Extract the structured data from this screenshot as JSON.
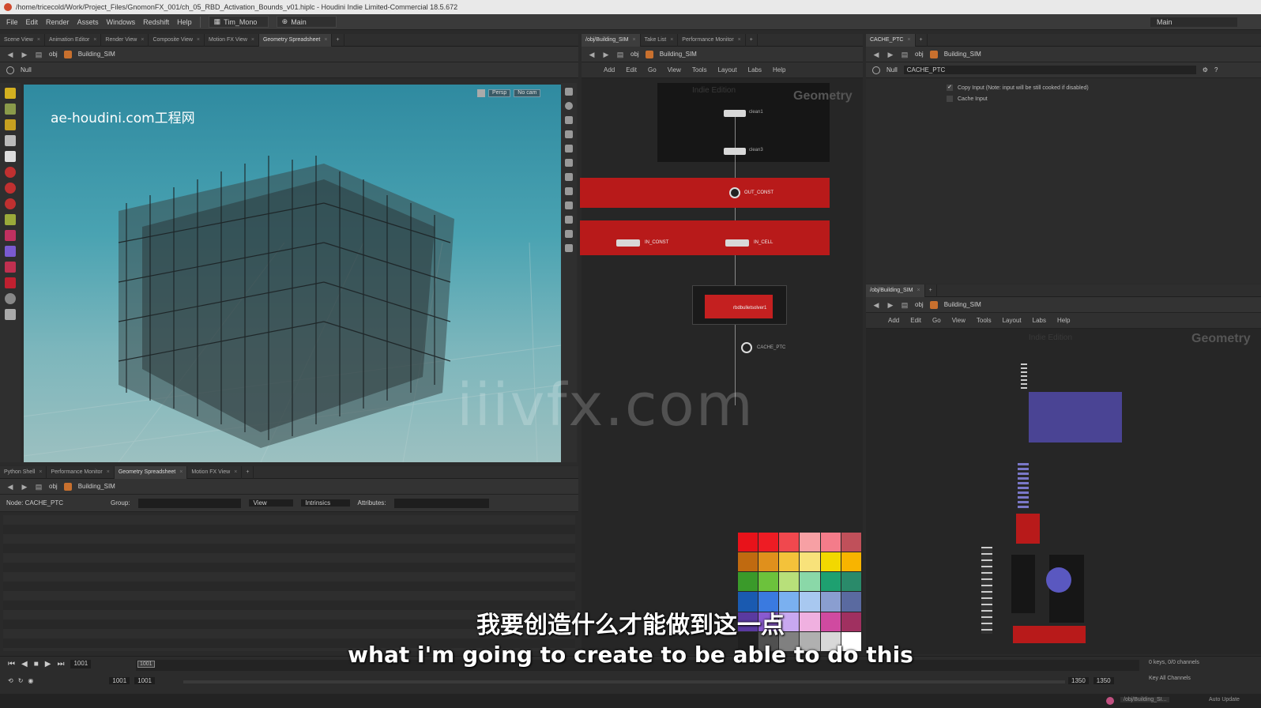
{
  "window": {
    "title": "/home/tricecold/Work/Project_Files/GnomonFX_001/ch_05_RBD_Activation_Bounds_v01.hiplc - Houdini Indie Limited-Commercial 18.5.672"
  },
  "menubar": {
    "items": [
      "File",
      "Edit",
      "Render",
      "Assets",
      "Windows",
      "Redshift",
      "Help"
    ],
    "desktop": "Tim_Mono",
    "desktop_right": "Main",
    "right_desktop": "Main"
  },
  "viewer_pane": {
    "tabs": [
      "Scene View",
      "Animation Editor",
      "Render View",
      "Composite View",
      "Motion FX View",
      "Geometry Spreadsheet"
    ],
    "path": [
      "obj",
      "Building_SIM"
    ],
    "node_label": "Null",
    "cam_buttons": [
      "Persp",
      "No cam"
    ],
    "watermark": "ae-houdini.com工程网"
  },
  "center_watermark": "iiivfx.com",
  "network_top": {
    "tabs": [
      "/obj/Building_SIM",
      "Take List",
      "Performance Monitor"
    ],
    "path": [
      "obj",
      "Building_SIM"
    ],
    "menu": [
      "Add",
      "Edit",
      "Go",
      "View",
      "Tools",
      "Layout",
      "Labs",
      "Help"
    ],
    "context_label": "Geometry",
    "faint_label": "Indie Edition",
    "nodes": {
      "n1": "clean1",
      "n2": "clean3",
      "out_const": "OUT_CONST",
      "in_const": "IN_CONST",
      "in_cell": "IN_CELL",
      "solver": "rbdbulletsolver1",
      "cache": "CACHE_PTC"
    }
  },
  "params_pane": {
    "tabs": [
      "CACHE_PTC"
    ],
    "path": [
      "obj",
      "Building_SIM"
    ],
    "node_type": "Null",
    "node_name": "CACHE_PTC",
    "params": [
      {
        "label": "Copy Input (Note: input will be still cooked if disabled)",
        "checked": true
      },
      {
        "label": "Cache Input",
        "checked": false
      }
    ]
  },
  "network_bottom": {
    "tabs": [
      "/obj/Building_SIM"
    ],
    "path": [
      "obj",
      "Building_SIM"
    ],
    "menu": [
      "Add",
      "Edit",
      "Go",
      "View",
      "Tools",
      "Layout",
      "Labs",
      "Help"
    ],
    "context_label": "Geometry",
    "faint_label": "Indie Edition"
  },
  "spreadsheet_pane": {
    "tabs": [
      "Python Shell",
      "Performance Monitor",
      "Geometry Spreadsheet",
      "Motion FX View"
    ],
    "path": [
      "obj",
      "Building_SIM"
    ],
    "node_label": "Node: CACHE_PTC",
    "group_label": "Group:",
    "view_label": "View",
    "intrinsics_label": "Intrinsics",
    "attributes_label": "Attributes:"
  },
  "timeline": {
    "current_frame": "1001",
    "frame_marker": "1001",
    "start": "1001",
    "start2": "1001",
    "end": "1350",
    "end2": "1350",
    "keys_label": "0 keys, 0/0 channels",
    "key_all": "Key All Channels",
    "auto_update": "Auto Update",
    "path_status": "/obj/Building_SI..."
  },
  "subtitles": {
    "cn": "我要创造什么才能做到这一点",
    "en": "what i'm going to create to be able to do this"
  },
  "palette_colors": [
    "#e8121a",
    "#ee1c24",
    "#f0484e",
    "#f7a0a4",
    "#f47c8a",
    "#c0505a",
    "#c06a10",
    "#e0901c",
    "#f4c23a",
    "#f8e27a",
    "#f2d800",
    "#f8b400",
    "#3a9a2a",
    "#6cc23c",
    "#b8e07a",
    "#8ad8a8",
    "#1ea070",
    "#2a8a6a",
    "#1a5ab0",
    "#3a7ae0",
    "#7ab0f0",
    "#a8c8f0",
    "#8a9ed0",
    "#5a6aa0",
    "#5a3aa0",
    "#8a5ad0",
    "#c8a8f0",
    "#f0b0e0",
    "#d04aa0",
    "#a03060",
    "#202020",
    "#505050",
    "#808080",
    "#b0b0b0",
    "#d8d8d8",
    "#ffffff"
  ]
}
